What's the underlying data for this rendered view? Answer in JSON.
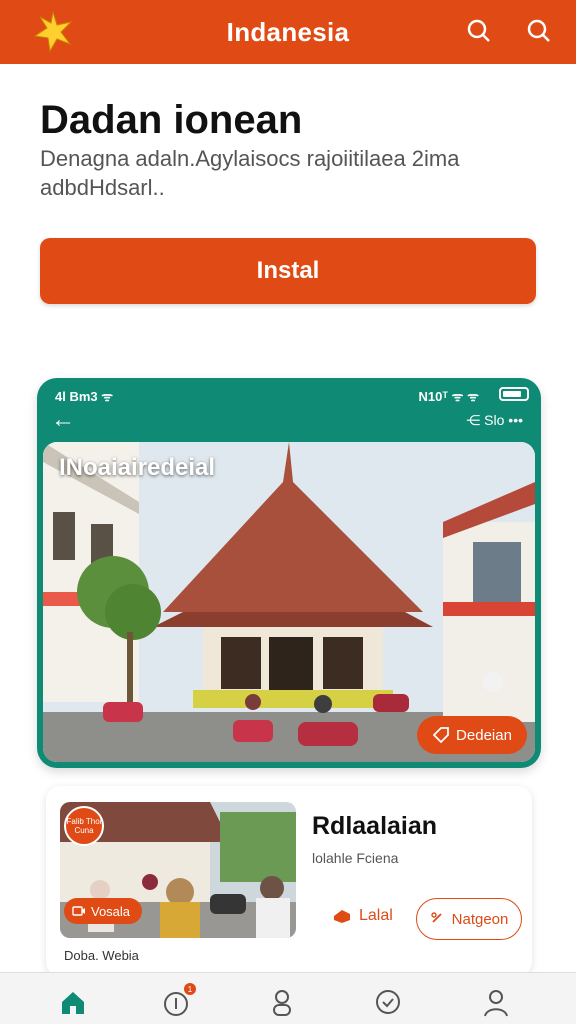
{
  "header": {
    "title": "Indanesia",
    "logo_icon": "star-logo",
    "search_icons": [
      "search-icon",
      "search-icon"
    ]
  },
  "hero": {
    "title": "Dadan ionean",
    "description": "Denagna adaln.Agylaisocs rajoiitilaea 2ima adbdHdsarl..",
    "install_label": "Instal"
  },
  "phone": {
    "status_left": "4l Bm3 ᯤ",
    "status_right": "N10ᵀ ᯤ ᯤ",
    "appbar_right": "⋲ Slo   •••",
    "photo_caption": "INoaiairedeial",
    "detail_label": "Dedeian"
  },
  "card": {
    "tag_label": "Falib Thoi Cuna",
    "video_label": "Vosala",
    "under_label": "Doba. Webia",
    "title": "Rdlaalaian",
    "subtitle": "lolahle Fciena",
    "like_label": "Lalal",
    "network_label": "Natgeon"
  },
  "bottom_nav": {
    "items": [
      "home-icon",
      "notification-icon",
      "user-group-icon",
      "message-icon",
      "profile-icon"
    ],
    "badge_count": "1"
  },
  "colors": {
    "accent": "#e04a15",
    "teal": "#0f8a75"
  }
}
